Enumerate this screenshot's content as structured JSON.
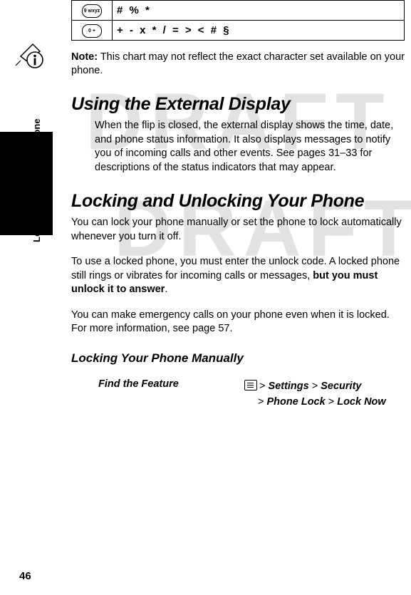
{
  "watermark": {
    "line1": "DRAFT",
    "line2": "DRAFT"
  },
  "side_label": "Learning to Use Your Phone",
  "page_number": "46",
  "charset_table": {
    "rows": [
      {
        "key": "9 wxyz",
        "chars": "#  %  *"
      },
      {
        "key": "0 +",
        "chars": "+  -  x  *  /  =  >  <  #  §"
      }
    ]
  },
  "note": {
    "label": "Note:",
    "text": " This chart may not reflect the exact character set available on your phone."
  },
  "sections": [
    {
      "heading": "Using the External Display",
      "paragraph": "When the flip is closed, the external display shows the time, date, and phone status information. It also displays messages to notify you of incoming calls and other events. See pages 31–33 for descriptions of the status indicators that may appear."
    }
  ],
  "locking": {
    "heading": "Locking and Unlocking Your Phone",
    "p1": "You can lock your phone manually or set the phone to lock automatically whenever you turn it off.",
    "p2_a": "To use a locked phone, you must enter the unlock code. A locked phone still rings or vibrates for incoming calls or messages, ",
    "p2_b": "but you must unlock it to answer",
    "p2_c": ".",
    "p3": "You can make emergency calls on your phone even when it is locked. For more information, see page 57.",
    "subheading": "Locking Your Phone Manually",
    "find_label": "Find the Feature",
    "path_line1_pre": "> ",
    "path_line1_a": "Settings",
    "path_line1_sep": " > ",
    "path_line1_b": "Security",
    "path_line2_pre": "> ",
    "path_line2_a": "Phone Lock",
    "path_line2_sep": " > ",
    "path_line2_b": "Lock Now"
  },
  "icons": {
    "menu_key": "menu-key-icon",
    "note_info": "info-icon"
  }
}
